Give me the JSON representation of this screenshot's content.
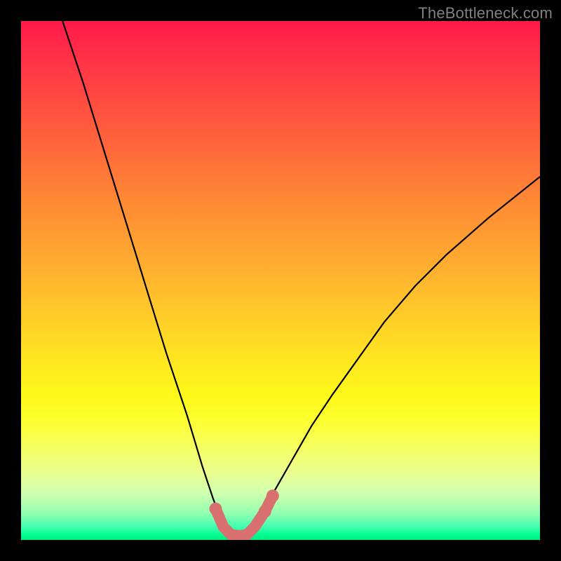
{
  "watermark": "TheBottleneck.com",
  "chart_data": {
    "type": "line",
    "title": "",
    "xlabel": "",
    "ylabel": "",
    "xlim": [
      0,
      100
    ],
    "ylim": [
      0,
      100
    ],
    "series": [
      {
        "name": "bottleneck-curve",
        "x": [
          8,
          12,
          16,
          20,
          24,
          28,
          32,
          35,
          37,
          38.5,
          40,
          41.5,
          43,
          44.5,
          46,
          48,
          52,
          56,
          60,
          65,
          70,
          76,
          82,
          90,
          100
        ],
        "y": [
          100,
          88,
          75,
          62,
          49,
          36,
          24,
          14,
          8,
          4,
          1.5,
          0.7,
          0.7,
          1.5,
          4,
          8,
          15,
          22,
          28,
          35,
          42,
          49,
          55,
          62,
          70
        ]
      }
    ],
    "markers": {
      "name": "highlighted-points",
      "points": [
        {
          "x": 37.5,
          "y": 6
        },
        {
          "x": 39,
          "y": 2.5
        },
        {
          "x": 40.5,
          "y": 1
        },
        {
          "x": 42,
          "y": 0.8
        },
        {
          "x": 43.5,
          "y": 1
        },
        {
          "x": 45,
          "y": 2.5
        },
        {
          "x": 47,
          "y": 5.5
        },
        {
          "x": 48.5,
          "y": 8.5
        }
      ],
      "color": "#d97070"
    },
    "gradient_stops": [
      {
        "pos": 0,
        "color": "#ff1a4a"
      },
      {
        "pos": 50,
        "color": "#ffc028"
      },
      {
        "pos": 75,
        "color": "#fff81a"
      },
      {
        "pos": 100,
        "color": "#00e880"
      }
    ]
  }
}
